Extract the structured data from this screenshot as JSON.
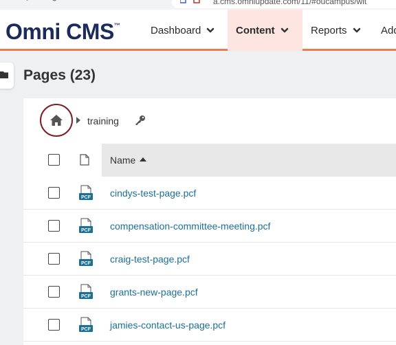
{
  "browser": {
    "url_text": "a.cms.omniupdate.com/11/#oucampus/wit"
  },
  "header": {
    "logo": "Omni CMS",
    "nav": [
      {
        "label": "Dashboard"
      },
      {
        "label": "Content"
      },
      {
        "label": "Reports"
      },
      {
        "label": "Add"
      }
    ]
  },
  "page": {
    "title": "Pages (23)"
  },
  "breadcrumb": {
    "current": "training"
  },
  "table": {
    "name_header": "Name",
    "sort": "ascending",
    "file_badge": "PCF",
    "rows": [
      {
        "name": "cindys-test-page.pcf"
      },
      {
        "name": "compensation-committee-meeting.pcf"
      },
      {
        "name": "craig-test-page.pcf"
      },
      {
        "name": "grants-new-page.pcf"
      },
      {
        "name": "jamies-contact-us-page.pcf"
      }
    ]
  },
  "colors": {
    "accent": "#e97b4f",
    "brand": "#1b2b5a",
    "active_tab_bg": "#fde6e1",
    "link": "#1a6f99",
    "home_ring": "#7a1f25",
    "pcf_badge": "#1a6f99"
  },
  "icons": [
    "back-icon",
    "reload-icon",
    "folder-icon",
    "home-icon",
    "caret-right-icon",
    "key-icon",
    "file-icon",
    "pcf-file-icon",
    "sort-asc-icon",
    "chevron-down-icon"
  ]
}
